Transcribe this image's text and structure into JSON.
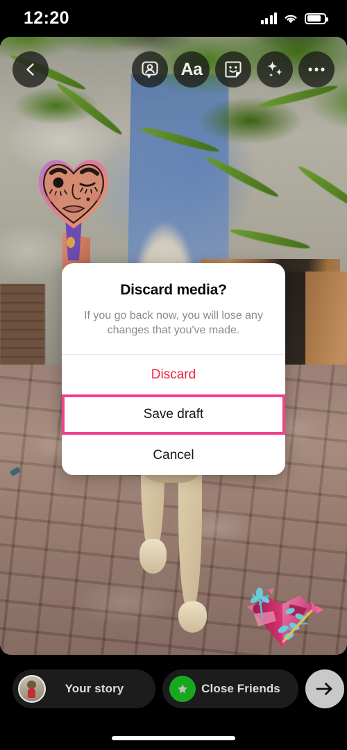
{
  "status_bar": {
    "time": "12:20",
    "signal_icon": "cellular-signal-icon",
    "wifi_icon": "wifi-icon",
    "battery_icon": "battery-icon",
    "battery_level_percent": 82
  },
  "toolbar": {
    "back": {
      "label": "",
      "icon": "chevron-left-icon"
    },
    "items": [
      {
        "icon": "add-yours-person-frame-icon",
        "label": ""
      },
      {
        "icon": "text-aa-icon",
        "label": "Aa"
      },
      {
        "icon": "sticker-smiley-icon",
        "label": ""
      },
      {
        "icon": "sparkles-effects-icon",
        "label": ""
      },
      {
        "icon": "more-ellipsis-icon",
        "label": ""
      }
    ]
  },
  "media": {
    "description": "Photo of a light-coloured dog standing on red brick pavers in front of a blue and white painted wall with a wooden door, green leaves overhead",
    "stickers": [
      {
        "name": "heart-face-mirror-sticker",
        "description": "Illustrated hand-held heart mirror with a winking face"
      },
      {
        "name": "heart-flowers-arrow-sticker",
        "description": "Pink 3D heart with teal leaves and an arrow"
      }
    ]
  },
  "dialog": {
    "title": "Discard media?",
    "message": "If you go back now, you will lose any changes that you've made.",
    "buttons": [
      {
        "label": "Discard",
        "style": "destructive",
        "highlighted": false
      },
      {
        "label": "Save draft",
        "style": "default",
        "highlighted": true
      },
      {
        "label": "Cancel",
        "style": "default",
        "highlighted": false
      }
    ],
    "highlight_color": "#f4408b",
    "destructive_color": "#f5213f"
  },
  "bottom_bar": {
    "your_story": {
      "label": "Your story",
      "avatar": "user-avatar"
    },
    "close_friends": {
      "label": "Close Friends",
      "badge_icon": "green-star-icon",
      "badge_color": "#17a820"
    },
    "next": {
      "icon": "arrow-right-icon",
      "label": ""
    }
  },
  "home_indicator": {
    "name": "home-indicator"
  }
}
